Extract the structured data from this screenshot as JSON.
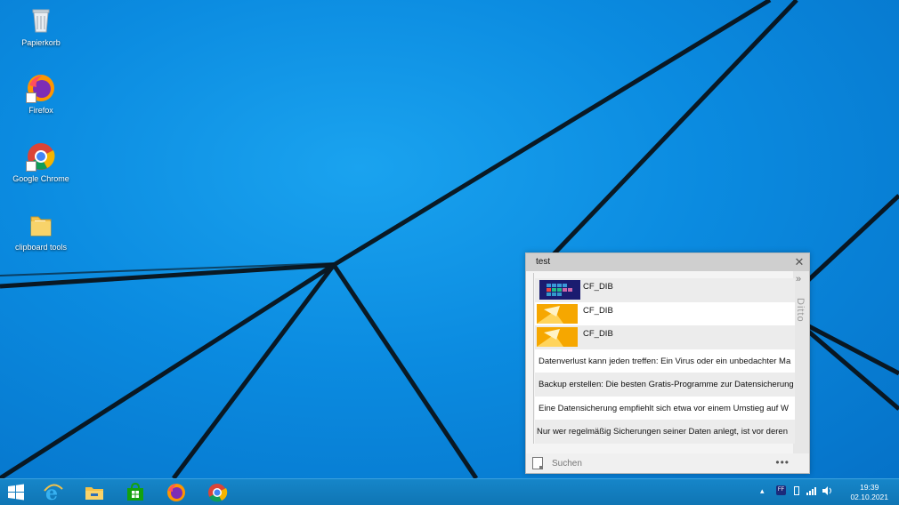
{
  "desktop": {
    "icons": [
      {
        "label": "Papierkorb",
        "icon": "recycle-bin-icon"
      },
      {
        "label": "Firefox",
        "icon": "firefox-icon"
      },
      {
        "label": "Google Chrome",
        "icon": "chrome-icon"
      },
      {
        "label": "clipboard tools",
        "icon": "folder-icon"
      }
    ]
  },
  "ditto": {
    "title": "test",
    "side_label": "Ditto",
    "clips": [
      {
        "type": "image",
        "label": "CF_DIB"
      },
      {
        "type": "image",
        "label": "CF_DIB"
      },
      {
        "type": "image",
        "label": "CF_DIB"
      },
      {
        "type": "text",
        "label": "Datenverlust kann jeden treffen: Ein Virus oder ein unbedachter Ma"
      },
      {
        "type": "text",
        "label": "Backup erstellen: Die besten Gratis-Programme zur Datensicherung"
      },
      {
        "type": "text",
        "label": "Eine Datensicherung empfiehlt sich etwa vor einem Umstieg auf W"
      },
      {
        "type": "text",
        "label": "Nur wer regelmäßig Sicherungen seiner Daten anlegt, ist vor deren"
      }
    ],
    "search_placeholder": "Suchen",
    "more_label": "•••"
  },
  "taskbar": {
    "items": [
      "windows-start-icon",
      "internet-explorer-icon",
      "file-explorer-icon",
      "store-icon",
      "firefox-icon",
      "chrome-icon"
    ],
    "tray_icon_label": "FF",
    "time": "19:39",
    "date": "02.10.2021"
  },
  "colors": {
    "taskbar": "#1180c2",
    "desktop_accent": "#0b8be0",
    "ditto_title": "#cfcfcf"
  }
}
